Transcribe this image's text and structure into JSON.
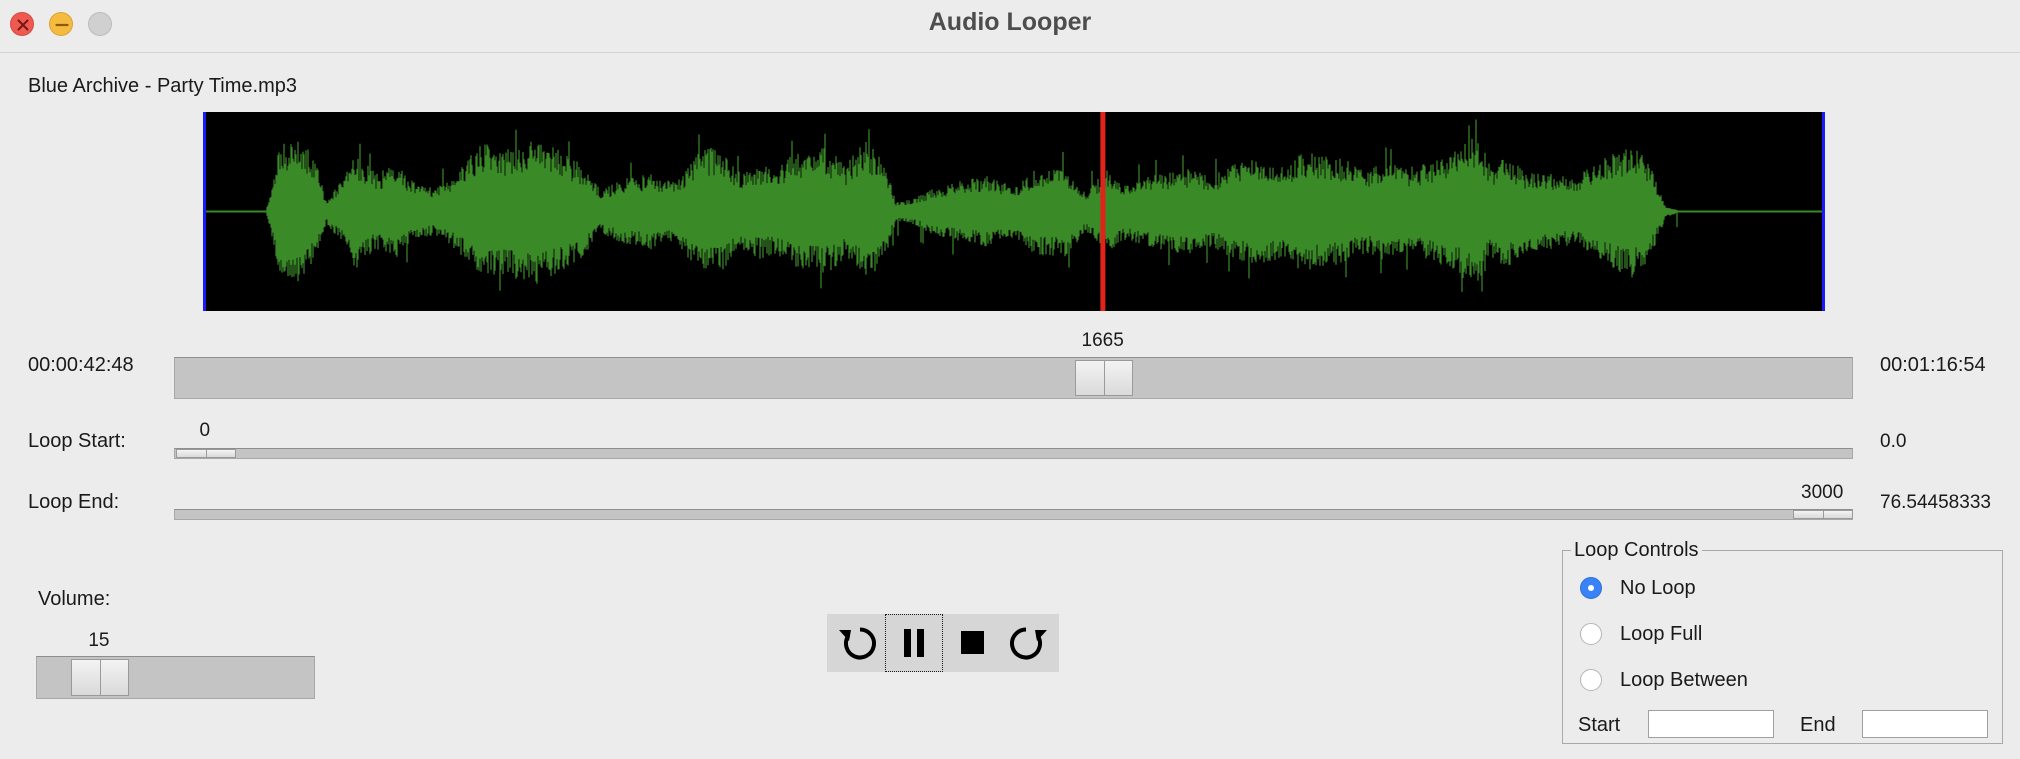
{
  "window": {
    "title": "Audio Looper"
  },
  "file": {
    "name": "Blue Archive - Party Time.mp3"
  },
  "waveform": {
    "wave_color": "#3a8a28",
    "background_color": "#000000",
    "playhead_color": "#e0241c",
    "loop_marker_color": "#1a1aff",
    "playhead_position": 0.555
  },
  "position": {
    "current_time": "00:00:42:48",
    "total_time": "00:01:16:54",
    "value": "1665",
    "max": 3000
  },
  "loop_start": {
    "label": "Loop Start:",
    "value": "0",
    "seconds": "0.0",
    "max": 3000
  },
  "loop_end": {
    "label": "Loop End:",
    "value": "3000",
    "seconds": "76.54458333",
    "max": 3000
  },
  "volume": {
    "label": "Volume:",
    "value": "15",
    "max": 100
  },
  "transport": {
    "buttons": [
      {
        "name": "rewind",
        "icon": "rewind-icon"
      },
      {
        "name": "pause",
        "icon": "pause-icon"
      },
      {
        "name": "stop",
        "icon": "stop-icon"
      },
      {
        "name": "forward",
        "icon": "forward-icon"
      }
    ]
  },
  "loop_controls": {
    "title": "Loop Controls",
    "options": [
      "No Loop",
      "Loop Full",
      "Loop Between"
    ],
    "selected": "No Loop",
    "start_label": "Start",
    "end_label": "End",
    "start_value": "",
    "end_value": ""
  },
  "colors": {
    "accent": "#3a82f7",
    "close": "#ee5a52",
    "minimize": "#f4bb3f",
    "maximize": "#d0d0d0"
  }
}
